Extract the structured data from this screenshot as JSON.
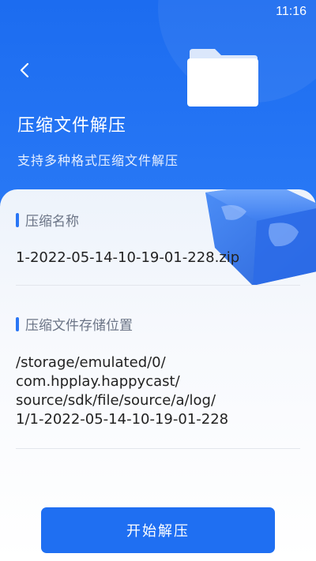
{
  "status_bar": {
    "time": "11:16"
  },
  "header": {
    "back_icon": "chevron-left-icon",
    "folder_icon": "folder-icon",
    "title": "压缩文件解压",
    "subtitle": "支持多种格式压缩文件解压"
  },
  "details": {
    "name_label": "压缩名称",
    "name_value": "1-2022-05-14-10-19-01-228.zip",
    "path_label": "压缩文件存储位置",
    "path_lines": [
      "/storage/emulated/0/",
      "com.hpplay.happycast/",
      "source/sdk/file/source/a/log/",
      "1/1-2022-05-14-10-19-01-228"
    ]
  },
  "actions": {
    "start_label": "开始解压"
  },
  "colors": {
    "primary": "#1f6ff2",
    "accent_bar": "#2a76f5"
  }
}
